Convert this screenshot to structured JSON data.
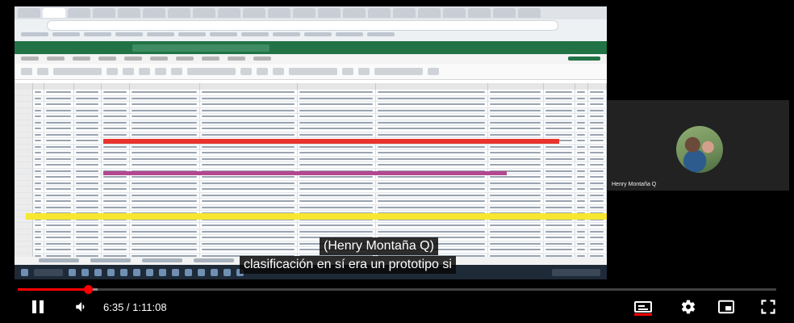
{
  "participant": {
    "name": "Henry Montaña Q"
  },
  "captions": {
    "line1": "(Henry Montaña Q)",
    "line2": "clasificación en sí era un prototipo si"
  },
  "player": {
    "time_display": "6:35 / 1:11:08",
    "current_time": "6:35",
    "duration": "1:11:08",
    "progress_fraction": 0.0926,
    "buffered_fraction": 0.105,
    "state": "playing",
    "captions_enabled": true,
    "icons": [
      "pause-icon",
      "volume-icon",
      "subtitles-icon",
      "settings-gear-icon",
      "miniplayer-icon",
      "fullscreen-icon"
    ],
    "accent_color": "#ff0000"
  },
  "shared_screen": {
    "app": "Excel spreadsheet (illegible)",
    "highlight_colors": [
      "#e8332e",
      "#b3478f",
      "#f7e731"
    ],
    "title_bar_color": "#217346"
  }
}
